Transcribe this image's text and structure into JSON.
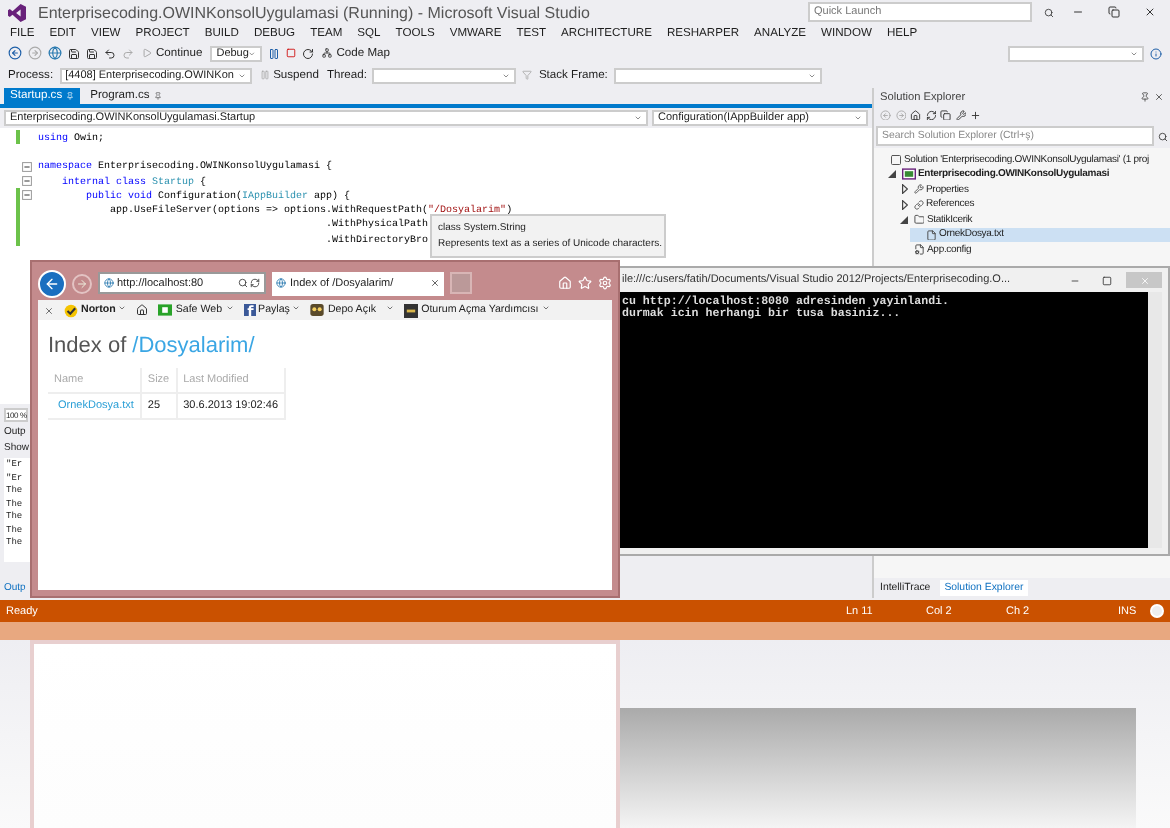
{
  "window": {
    "title": "Enterprisecoding.OWINKonsolUygulamasi (Running) - Microsoft Visual Studio",
    "quick_launch": {
      "placeholder": "Quick Launch"
    }
  },
  "menu": [
    "FILE",
    "EDIT",
    "VIEW",
    "PROJECT",
    "BUILD",
    "DEBUG",
    "TEAM",
    "SQL",
    "TOOLS",
    "VMWARE",
    "TEST",
    "ARCHITECTURE",
    "RESHARPER",
    "ANALYZE",
    "WINDOW",
    "HELP"
  ],
  "toolbar": {
    "continue": "Continue",
    "configuration": "Debug",
    "code_map": "Code Map"
  },
  "debug_bar": {
    "process_label": "Process:",
    "process": "[4408] Enterprisecoding.OWINKon",
    "suspend": "Suspend",
    "thread_label": "Thread:",
    "stack_frame_label": "Stack Frame:"
  },
  "doc_tabs": [
    {
      "label": "Startup.cs",
      "selected": true
    },
    {
      "label": "Program.cs",
      "selected": false
    }
  ],
  "nav_bar": {
    "type": "Enterprisecoding.OWINKonsolUygulamasi.Startup",
    "member": "Configuration(IAppBuilder app)"
  },
  "code_lines": [
    {
      "changed": true,
      "foldable": false,
      "tokens": [
        {
          "kind": "keyword",
          "text": "using"
        },
        {
          "kind": "plain",
          "text": " Owin;"
        }
      ]
    },
    {
      "changed": false,
      "foldable": false
    },
    {
      "changed": false,
      "foldable": true,
      "tokens": [
        {
          "kind": "keyword",
          "text": "namespace"
        },
        {
          "kind": "plain",
          "text": " Enterprisecoding.OWINKonsolUygulamasi {"
        }
      ]
    },
    {
      "changed": false,
      "foldable": true,
      "tokens": [
        {
          "kind": "keyword",
          "text": "    internal class "
        },
        {
          "kind": "type",
          "text": "Startup"
        },
        {
          "kind": "plain",
          "text": " {"
        }
      ]
    },
    {
      "changed": true,
      "foldable": true,
      "tokens": [
        {
          "kind": "keyword",
          "text": "        public void"
        },
        {
          "kind": "plain",
          "text": " Configuration("
        },
        {
          "kind": "type",
          "text": "IAppBuilder"
        },
        {
          "kind": "plain",
          "text": " app) {"
        }
      ]
    },
    {
      "changed": true,
      "foldable": false,
      "tokens": [
        {
          "kind": "plain",
          "text": "            app.UseFileServer(options => options.WithRequestPath("
        },
        {
          "kind": "string",
          "text": "\"/Dosyalarim\""
        },
        {
          "kind": "plain",
          "text": ")"
        }
      ]
    },
    {
      "changed": true,
      "foldable": false,
      "tokens": [
        {
          "kind": "plain",
          "text": "                                                .WithPhysicalPath"
        }
      ]
    },
    {
      "changed": true,
      "foldable": false,
      "tokens": [
        {
          "kind": "plain",
          "text": "                                                .WithDirectoryBro"
        }
      ]
    }
  ],
  "tooltip": {
    "title": "class System.String",
    "description": "Represents text as a series of Unicode characters."
  },
  "output": {
    "zoom": "100 %",
    "title": "Outp",
    "show_label": "Show",
    "lines": [
      "\"Er",
      "\"Er",
      "The",
      "The",
      "The",
      "The",
      "The"
    ],
    "tab": "Outp"
  },
  "solution_explorer": {
    "title": "Solution Explorer",
    "search": {
      "placeholder": "Search Solution Explorer (Ctrl+ş)"
    },
    "tree": [
      {
        "kind": "solution",
        "label": "Solution 'Enterprisecoding.OWINKonsolUygulamasi' (1 proj",
        "selected": false,
        "children": [
          {
            "kind": "project",
            "label": "Enterprisecoding.OWINKonsolUygulamasi",
            "selected": false,
            "expanded": true,
            "children": [
              {
                "kind": "properties",
                "label": "Properties",
                "selected": false,
                "expanded": false
              },
              {
                "kind": "references",
                "label": "References",
                "selected": false,
                "expanded": false
              },
              {
                "kind": "folder",
                "label": "StatikIcerik",
                "selected": false,
                "expanded": true,
                "children": [
                  {
                    "kind": "file",
                    "label": "OrnekDosya.txt",
                    "selected": true
                  }
                ]
              },
              {
                "kind": "config",
                "label": "App.config",
                "selected": false
              }
            ]
          }
        ]
      }
    ]
  },
  "bottom_tabs": [
    {
      "label": "IntelliTrace",
      "selected": false
    },
    {
      "label": "Solution Explorer",
      "selected": true
    }
  ],
  "status_bar": {
    "message": "Ready",
    "line": "Ln 11",
    "col": "Col 2",
    "ch": "Ch 2",
    "mode": "INS"
  },
  "console": {
    "title": "ile:///c:/users/fatih/Documents/Visual Studio 2012/Projects/Enterprisecoding.O...",
    "lines": [
      "cu http://localhost:8080 adresinden yayinlandi.",
      "durmak icin herhangi bir tusa basiniz..."
    ]
  },
  "browser": {
    "address": "http://localhost:80",
    "tab": "Index of /Dosyalarim/",
    "favorites": [
      {
        "kind": "norton",
        "label": "Norton",
        "dropdown": true
      },
      {
        "kind": "home",
        "dropdown": false
      },
      {
        "kind": "safe_web",
        "label": "Safe Web",
        "dropdown": true
      },
      {
        "kind": "share",
        "label": "Paylaş",
        "dropdown": true
      },
      {
        "kind": "depo",
        "label": "Depo Açık",
        "dropdown": false
      },
      {
        "kind": "more",
        "dropdown": true
      },
      {
        "kind": "login",
        "label": "Oturum Açma Yardımcısı",
        "dropdown": true
      }
    ],
    "heading": "Index of",
    "heading_path": "/Dosyalarim/",
    "table": {
      "columns": [
        "Name",
        "Size",
        "Last Modified"
      ],
      "rows": [
        [
          "OrnekDosya.txt",
          "25",
          "30.6.2013 19:02:46"
        ]
      ]
    }
  }
}
